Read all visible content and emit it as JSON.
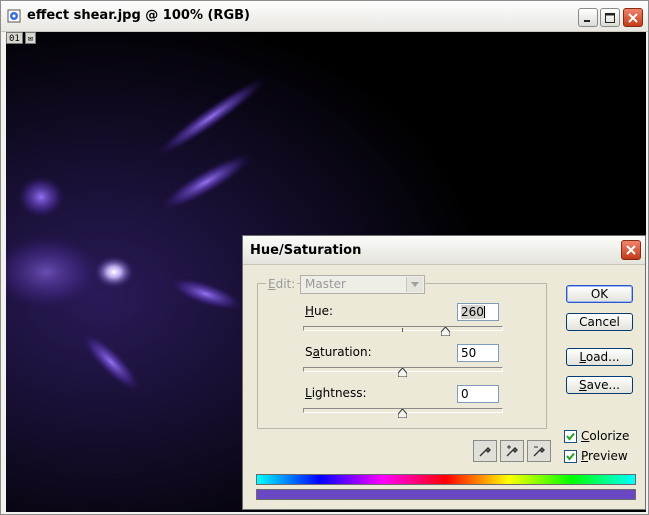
{
  "window": {
    "title": "effect shear.jpg @ 100% (RGB)",
    "status_items": [
      "01",
      "✉"
    ]
  },
  "dialog": {
    "title": "Hue/Saturation",
    "edit": {
      "label_prefix": "",
      "label_underlined": "E",
      "label_suffix": "dit:",
      "value": "Master"
    },
    "hue": {
      "label_u": "H",
      "label_rest": "ue:",
      "value": "260"
    },
    "saturation": {
      "label_pre": "S",
      "label_u": "a",
      "label_rest": "turation:",
      "value": "50"
    },
    "lightness": {
      "label_pre": "",
      "label_u": "L",
      "label_rest": "ightness:",
      "value": "0"
    },
    "buttons": {
      "ok": "OK",
      "cancel": "Cancel",
      "load_u": "L",
      "load_rest": "oad...",
      "save_u": "S",
      "save_rest": "ave..."
    },
    "colorize": {
      "label_u": "C",
      "label_rest": "olorize",
      "checked": true
    },
    "preview": {
      "label_u": "P",
      "label_rest": "review",
      "checked": true
    },
    "colorized_bar_color": "#6a48c4"
  },
  "colors": {
    "canvas_background": "#000000",
    "glow": "#7a55e0",
    "dialog_background": "#ece9d8",
    "close_button": "#d4492a"
  },
  "slider_levels": {
    "hue_fraction": 0.722,
    "saturation_fraction": 0.5,
    "lightness_fraction": 0.5
  }
}
